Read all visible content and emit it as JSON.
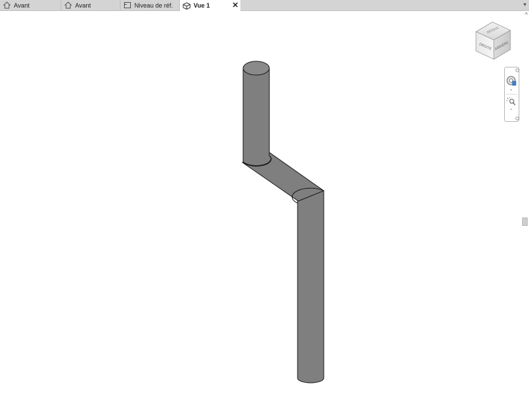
{
  "tabs": [
    {
      "label": "Avant",
      "icon": "elevation-icon",
      "active": false
    },
    {
      "label": "Avant",
      "icon": "elevation-icon",
      "active": false
    },
    {
      "label": "Niveau de réf.",
      "icon": "floor-plan-icon",
      "active": false
    },
    {
      "label": "Vue 1",
      "icon": "3d-view-icon",
      "active": true
    }
  ],
  "tab_close_glyph": "✕",
  "tab_menu_glyph": "▾",
  "scroll_up_glyph": "^",
  "viewcube": {
    "faces": {
      "top": "DESSUS",
      "front": "DROITE",
      "right": "ARRIÈRE"
    }
  },
  "colors": {
    "pipe_fill": "#7f7f7f",
    "pipe_top": "#8a8a8a",
    "pipe_stroke": "#1a1a1a",
    "tabbar_bg": "#d4d4d4",
    "accent_blue": "#3b7fd1"
  }
}
